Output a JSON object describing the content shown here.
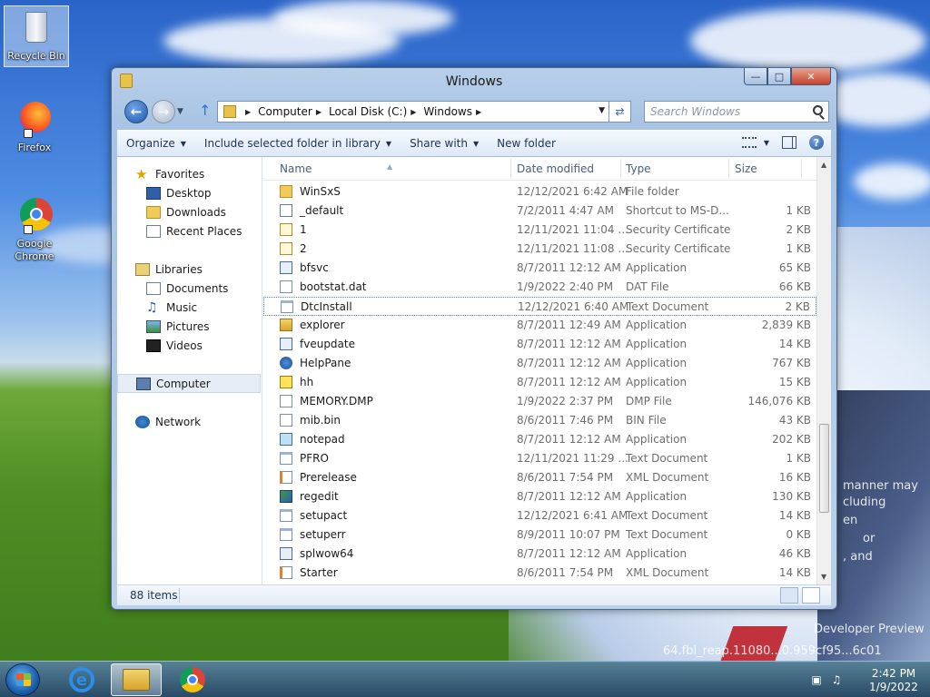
{
  "desktop": {
    "icons": [
      {
        "label": "Recycle Bin"
      },
      {
        "label": "Firefox"
      },
      {
        "label": "Google Chrome"
      }
    ],
    "watermark_lines": [
      "manner may",
      "cluding",
      "en",
      "or",
      ", and",
      "Developer Preview",
      "64.fbl_reap.11080...0.959cf95...6c01"
    ]
  },
  "window": {
    "title": "Windows",
    "address": {
      "crumbs": [
        "Computer",
        "Local Disk (C:)",
        "Windows"
      ],
      "search_placeholder": "Search Windows"
    },
    "toolbar": {
      "organize": "Organize",
      "include": "Include selected folder in library",
      "share": "Share with",
      "new_folder": "New folder"
    },
    "nav": {
      "favorites": "Favorites",
      "desktop": "Desktop",
      "downloads": "Downloads",
      "recent": "Recent Places",
      "libraries": "Libraries",
      "documents": "Documents",
      "music": "Music",
      "pictures": "Pictures",
      "videos": "Videos",
      "computer": "Computer",
      "network": "Network"
    },
    "columns": {
      "name": "Name",
      "date": "Date modified",
      "type": "Type",
      "size": "Size"
    },
    "files": [
      {
        "name": "WinSxS",
        "date": "12/12/2021 6:42 AM",
        "type": "File folder",
        "size": "",
        "icon": "folder"
      },
      {
        "name": "_default",
        "date": "7/2/2011 4:47 AM",
        "type": "Shortcut to MS-D...",
        "size": "1 KB",
        "icon": "shortcut"
      },
      {
        "name": "1",
        "date": "12/11/2021 11:04 ...",
        "type": "Security Certificate",
        "size": "2 KB",
        "icon": "cert"
      },
      {
        "name": "2",
        "date": "12/11/2021 11:08 ...",
        "type": "Security Certificate",
        "size": "1 KB",
        "icon": "cert"
      },
      {
        "name": "bfsvc",
        "date": "8/7/2011 12:12 AM",
        "type": "Application",
        "size": "65 KB",
        "icon": "app"
      },
      {
        "name": "bootstat.dat",
        "date": "1/9/2022 2:40 PM",
        "type": "DAT File",
        "size": "66 KB",
        "icon": "file"
      },
      {
        "name": "DtcInstall",
        "date": "12/12/2021 6:40 AM",
        "type": "Text Document",
        "size": "2 KB",
        "icon": "txt"
      },
      {
        "name": "explorer",
        "date": "8/7/2011 12:49 AM",
        "type": "Application",
        "size": "2,839 KB",
        "icon": "explorer"
      },
      {
        "name": "fveupdate",
        "date": "8/7/2011 12:12 AM",
        "type": "Application",
        "size": "14 KB",
        "icon": "app"
      },
      {
        "name": "HelpPane",
        "date": "8/7/2011 12:12 AM",
        "type": "Application",
        "size": "767 KB",
        "icon": "help"
      },
      {
        "name": "hh",
        "date": "8/7/2011 12:12 AM",
        "type": "Application",
        "size": "15 KB",
        "icon": "hh"
      },
      {
        "name": "MEMORY.DMP",
        "date": "1/9/2022 2:37 PM",
        "type": "DMP File",
        "size": "146,076 KB",
        "icon": "file"
      },
      {
        "name": "mib.bin",
        "date": "8/6/2011 7:46 PM",
        "type": "BIN File",
        "size": "43 KB",
        "icon": "file"
      },
      {
        "name": "notepad",
        "date": "8/7/2011 12:12 AM",
        "type": "Application",
        "size": "202 KB",
        "icon": "notepad"
      },
      {
        "name": "PFRO",
        "date": "12/11/2021 11:29 ...",
        "type": "Text Document",
        "size": "1 KB",
        "icon": "txt"
      },
      {
        "name": "Prerelease",
        "date": "8/6/2011 7:54 PM",
        "type": "XML Document",
        "size": "16 KB",
        "icon": "xml"
      },
      {
        "name": "regedit",
        "date": "8/7/2011 12:12 AM",
        "type": "Application",
        "size": "130 KB",
        "icon": "regedit"
      },
      {
        "name": "setupact",
        "date": "12/12/2021 6:41 AM",
        "type": "Text Document",
        "size": "14 KB",
        "icon": "txt"
      },
      {
        "name": "setuperr",
        "date": "8/9/2011 10:07 PM",
        "type": "Text Document",
        "size": "0 KB",
        "icon": "txt"
      },
      {
        "name": "splwow64",
        "date": "8/7/2011 12:12 AM",
        "type": "Application",
        "size": "46 KB",
        "icon": "app"
      },
      {
        "name": "Starter",
        "date": "8/6/2011 7:54 PM",
        "type": "XML Document",
        "size": "14 KB",
        "icon": "xml"
      }
    ],
    "status": "88 items"
  },
  "taskbar": {
    "time": "2:42 PM",
    "date": "1/9/2022"
  }
}
